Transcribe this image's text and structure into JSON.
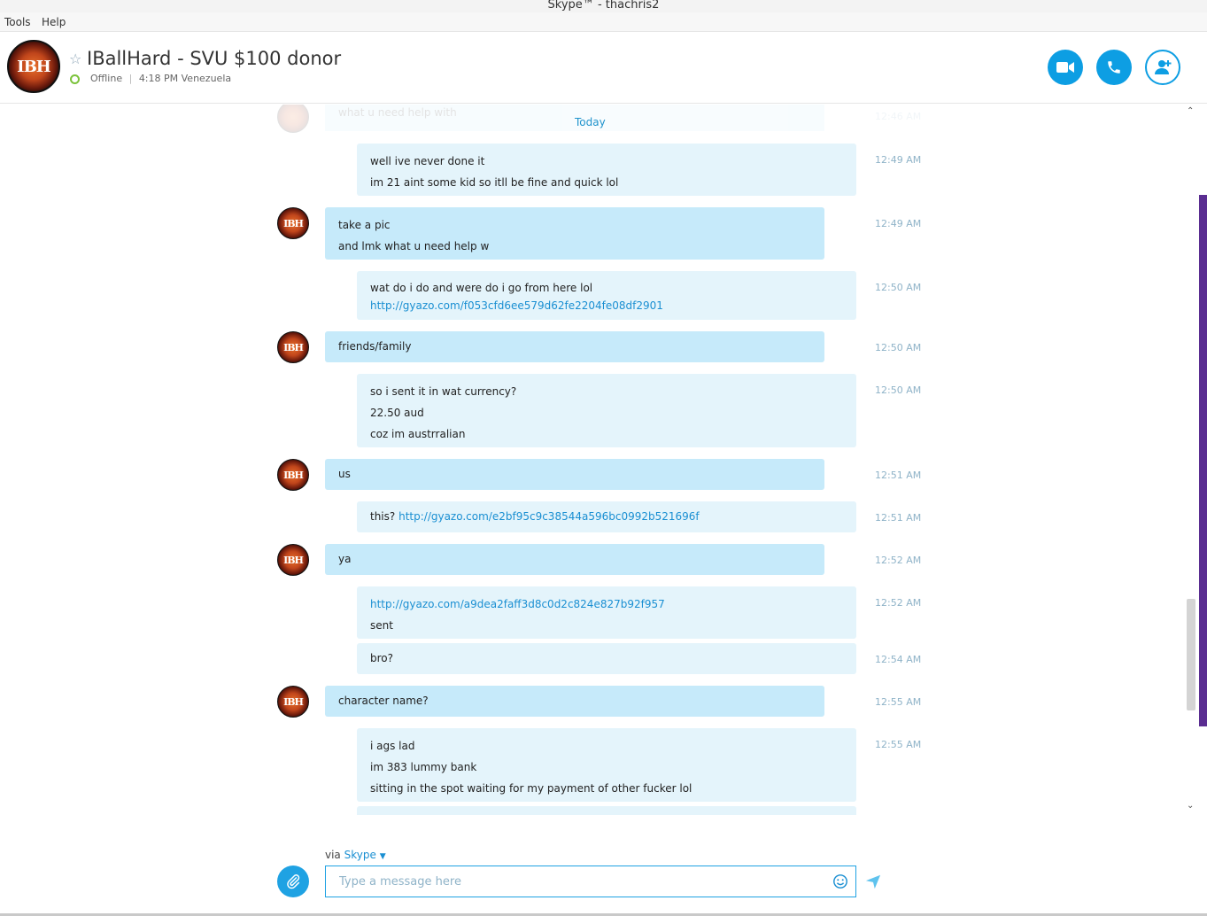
{
  "window": {
    "title": "Skype™ - thachris2"
  },
  "menu": {
    "items": [
      "Tools",
      "Help"
    ]
  },
  "contact": {
    "name": "IBallHard - SVU $100 donor",
    "status": "Offline",
    "local_time": "4:18 PM Venezuela",
    "avatar_text": "IBH"
  },
  "header_buttons": {
    "video": "video-call",
    "call": "voice-call",
    "add": "add-people"
  },
  "chat": {
    "faded_text": "what u need help with",
    "faded_time": "12:46 AM",
    "date_divider": "Today",
    "messages": [
      {
        "from": "me",
        "time": "12:49 AM",
        "lines": [
          "well ive never done it",
          "im 21 aint some kid so itll be fine and quick lol"
        ]
      },
      {
        "from": "them",
        "time": "12:49 AM",
        "lines": [
          "take a pic",
          "and lmk what u need help w"
        ]
      },
      {
        "from": "me",
        "time": "12:50 AM",
        "lines": [
          "wat do i do and were do i go from here lol",
          "http://gyazo.com/f053cfd6ee579d62fe2204fe08df2901"
        ]
      },
      {
        "from": "them",
        "time": "12:50 AM",
        "lines": [
          "friends/family"
        ]
      },
      {
        "from": "me",
        "time": "12:50 AM",
        "lines": [
          "so i sent it in wat currency?",
          "22.50 aud",
          "coz im austrralian"
        ]
      },
      {
        "from": "them",
        "time": "12:51 AM",
        "lines": [
          "us"
        ]
      },
      {
        "from": "me",
        "time": "12:51 AM",
        "prefix": "this?",
        "link": "http://gyazo.com/e2bf95c9c38544a596bc0992b521696f"
      },
      {
        "from": "them",
        "time": "12:52 AM",
        "lines": [
          "ya"
        ]
      },
      {
        "from": "me",
        "time": "12:52 AM",
        "lines": [
          "http://gyazo.com/a9dea2faff3d8c0d2c824e827b92f957",
          "sent"
        ]
      },
      {
        "from": "me",
        "time": "12:54 AM",
        "lines": [
          "bro?"
        ]
      },
      {
        "from": "them",
        "time": "12:55 AM",
        "lines": [
          "character name?"
        ]
      },
      {
        "from": "me",
        "time": "12:55 AM",
        "lines": [
          "i ags lad",
          "im 383 lummy bank",
          "sitting in the spot waiting for my payment of other fucker lol"
        ]
      }
    ]
  },
  "composer": {
    "via_label": "via",
    "via_service": "Skype",
    "placeholder": "Type a message here"
  }
}
